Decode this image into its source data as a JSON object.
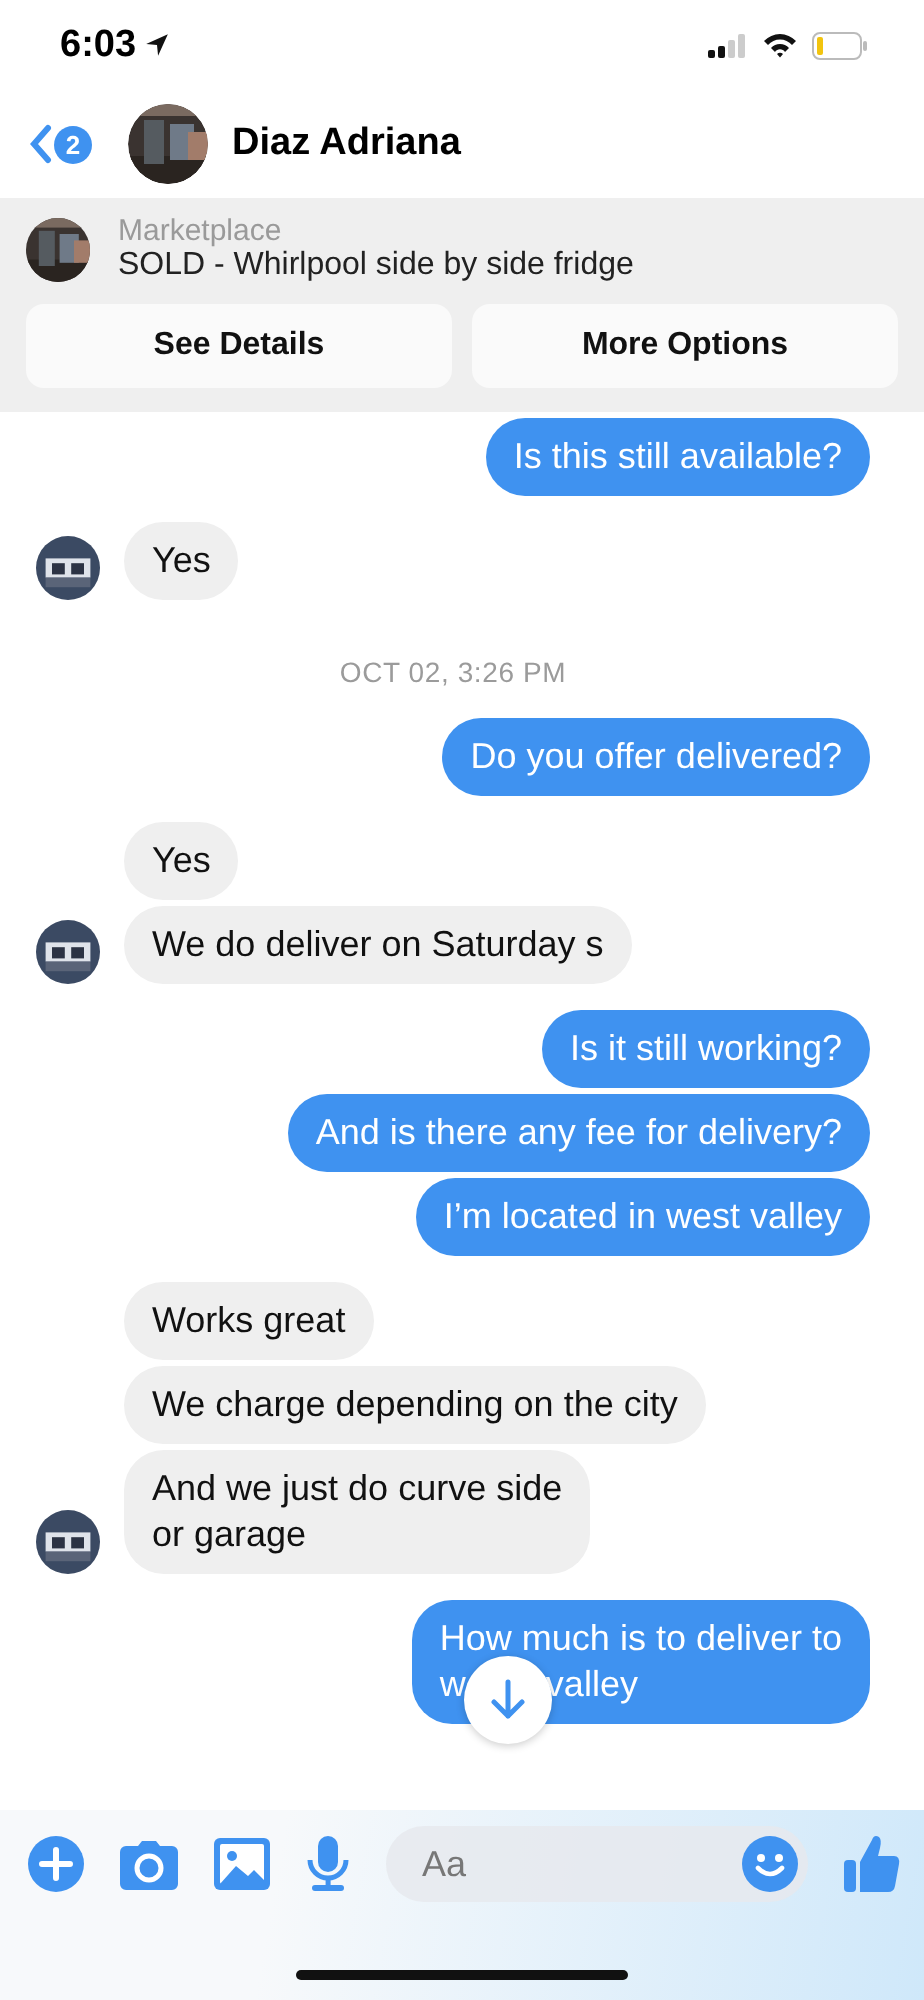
{
  "status_bar": {
    "time": "6:03"
  },
  "header": {
    "back_badge": "2",
    "contact_name": "Diaz Adriana"
  },
  "listing": {
    "source": "Marketplace",
    "title": "SOLD - Whirlpool side by side fridge",
    "buttons": [
      "See Details",
      "More Options"
    ]
  },
  "messages": [
    {
      "kind": "outgoing",
      "text": "Is this still available?"
    },
    {
      "kind": "incoming",
      "text": "Yes",
      "avatar": true
    },
    {
      "kind": "timestamp",
      "text": "OCT 02, 3:26 PM"
    },
    {
      "kind": "outgoing",
      "text": "Do you offer delivered?"
    },
    {
      "kind": "incoming",
      "text": "Yes",
      "avatar": false
    },
    {
      "kind": "incoming",
      "text": "We do deliver on Saturday s",
      "avatar": true
    },
    {
      "kind": "outgoing",
      "text": "Is it still working?"
    },
    {
      "kind": "outgoing",
      "text": "And is there any fee for delivery?"
    },
    {
      "kind": "outgoing",
      "text": "I’m located in west valley"
    },
    {
      "kind": "incoming",
      "text": "Works great",
      "avatar": false
    },
    {
      "kind": "incoming",
      "text": "We charge depending on the city",
      "avatar": false
    },
    {
      "kind": "incoming",
      "text": "And we just do curve side\nor garage",
      "avatar": true
    },
    {
      "kind": "outgoing",
      "text": "How much is to deliver to\nw        valley"
    }
  ],
  "composer": {
    "placeholder": "Aa"
  }
}
